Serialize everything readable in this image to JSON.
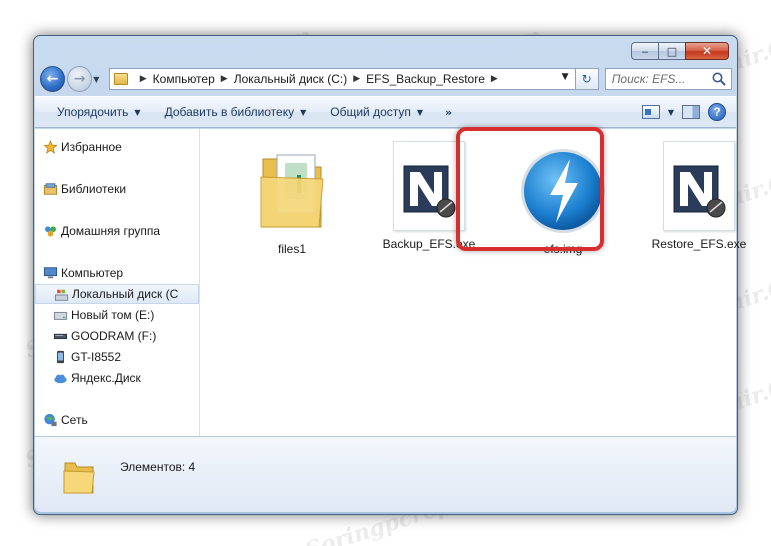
{
  "window": {
    "controls": {
      "minimize": "‒",
      "maximize": "□",
      "close": "✕"
    }
  },
  "address_bar": {
    "crumbs": [
      "Компьютер",
      "Локальный диск (C:)",
      "EFS_Backup_Restore"
    ],
    "search_placeholder": "Поиск: EFS..."
  },
  "toolbar": {
    "organize": "Упорядочить",
    "add_library": "Добавить в библиотеку",
    "share": "Общий доступ",
    "more": "»",
    "help": "?"
  },
  "nav_pane": {
    "favorites": "Избранное",
    "libraries": "Библиотеки",
    "homegroup": "Домашняя группа",
    "computer": "Компьютер",
    "drives": [
      "Локальный диск (C",
      "Новый том (E:)",
      "GOODRAM (F:)",
      "GT-I8552",
      "Яндекс.Диск"
    ],
    "network": "Сеть"
  },
  "files": [
    {
      "name": "files1",
      "type": "folder"
    },
    {
      "name": "Backup_EFS.exe",
      "type": "exe"
    },
    {
      "name": "efs.img",
      "type": "image",
      "highlighted": true
    },
    {
      "name": "Restore_EFS.exe",
      "type": "exe"
    }
  ],
  "status": {
    "text": "Элементов: 4"
  },
  "watermark": "Soringpcrepair.Com",
  "colors": {
    "highlight": "#d72f2f",
    "accent": "#1f5fb7"
  }
}
